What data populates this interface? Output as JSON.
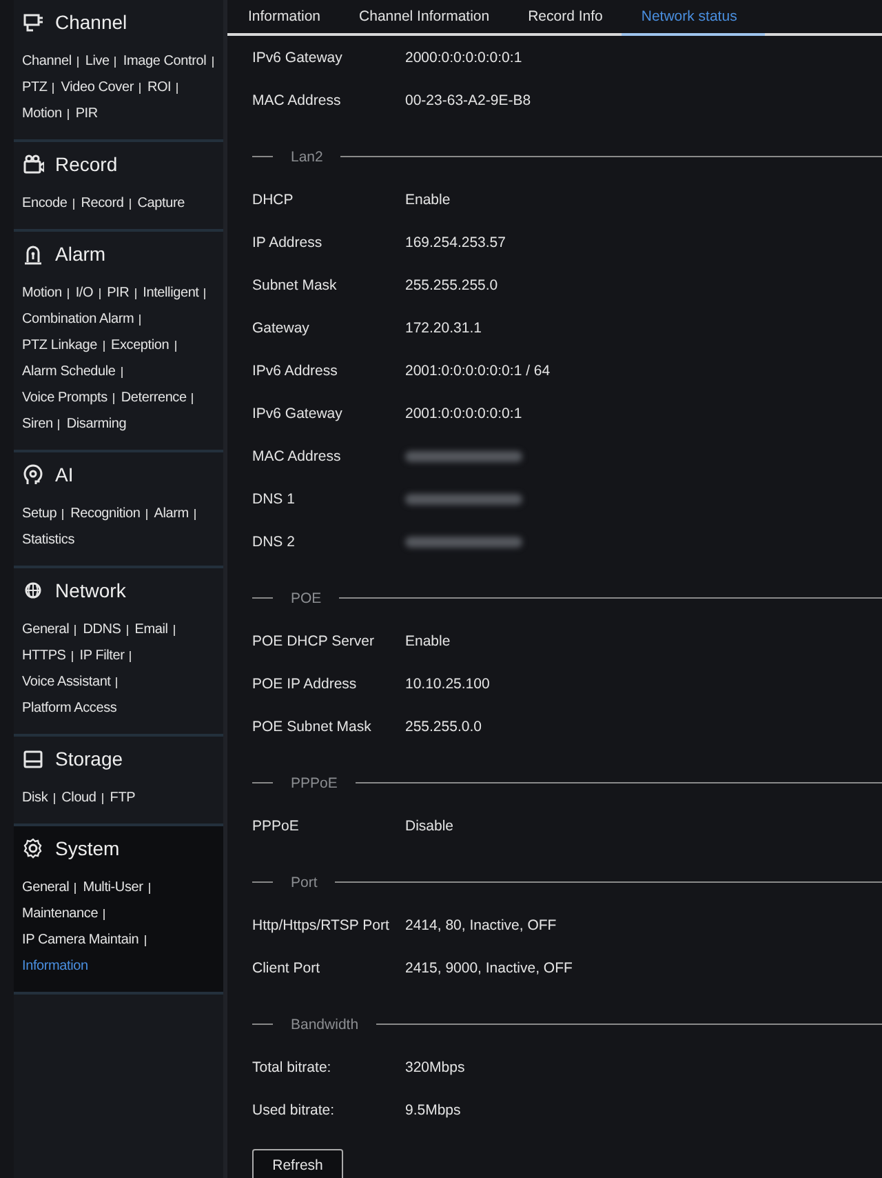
{
  "sidebar": {
    "sections": [
      {
        "title": "Channel",
        "selected": false,
        "links": [
          {
            "label": "Channel",
            "selected": false
          },
          {
            "label": "Live",
            "selected": false
          },
          {
            "label": "Image Control",
            "selected": false
          },
          {
            "label": "PTZ",
            "selected": false
          },
          {
            "label": "Video Cover",
            "selected": false
          },
          {
            "label": "ROI",
            "selected": false
          },
          {
            "label": "Motion",
            "selected": false
          },
          {
            "label": "PIR",
            "selected": false
          }
        ]
      },
      {
        "title": "Record",
        "selected": false,
        "links": [
          {
            "label": "Encode",
            "selected": false
          },
          {
            "label": "Record",
            "selected": false
          },
          {
            "label": "Capture",
            "selected": false
          }
        ]
      },
      {
        "title": "Alarm",
        "selected": false,
        "links": [
          {
            "label": "Motion",
            "selected": false
          },
          {
            "label": "I/O",
            "selected": false
          },
          {
            "label": "PIR",
            "selected": false
          },
          {
            "label": "Intelligent",
            "selected": false
          },
          {
            "label": "Combination Alarm",
            "selected": false
          },
          {
            "label": "PTZ Linkage",
            "selected": false
          },
          {
            "label": "Exception",
            "selected": false
          },
          {
            "label": "Alarm Schedule",
            "selected": false
          },
          {
            "label": "Voice Prompts",
            "selected": false
          },
          {
            "label": "Deterrence",
            "selected": false
          },
          {
            "label": "Siren",
            "selected": false
          },
          {
            "label": "Disarming",
            "selected": false
          }
        ]
      },
      {
        "title": "AI",
        "selected": false,
        "links": [
          {
            "label": "Setup",
            "selected": false
          },
          {
            "label": "Recognition",
            "selected": false
          },
          {
            "label": "Alarm",
            "selected": false
          },
          {
            "label": "Statistics",
            "selected": false
          }
        ]
      },
      {
        "title": "Network",
        "selected": false,
        "links": [
          {
            "label": "General",
            "selected": false
          },
          {
            "label": "DDNS",
            "selected": false
          },
          {
            "label": "Email",
            "selected": false
          },
          {
            "label": "HTTPS",
            "selected": false
          },
          {
            "label": "IP Filter",
            "selected": false
          },
          {
            "label": "Voice Assistant",
            "selected": false
          },
          {
            "label": "Platform Access",
            "selected": false
          }
        ]
      },
      {
        "title": "Storage",
        "selected": false,
        "links": [
          {
            "label": "Disk",
            "selected": false
          },
          {
            "label": "Cloud",
            "selected": false
          },
          {
            "label": "FTP",
            "selected": false
          }
        ]
      },
      {
        "title": "System",
        "selected": true,
        "links": [
          {
            "label": "General",
            "selected": false
          },
          {
            "label": "Multi-User",
            "selected": false
          },
          {
            "label": "Maintenance",
            "selected": false
          },
          {
            "label": "IP Camera Maintain",
            "selected": false
          },
          {
            "label": "Information",
            "selected": true
          }
        ]
      }
    ]
  },
  "tabs": [
    {
      "label": "Information",
      "selected": false
    },
    {
      "label": "Channel Information",
      "selected": false
    },
    {
      "label": "Record Info",
      "selected": false
    },
    {
      "label": "Network status",
      "selected": true
    }
  ],
  "content": {
    "sections": [
      {
        "rows": [
          {
            "label": "IPv6 Gateway",
            "value": "2000:0:0:0:0:0:0:1"
          },
          {
            "label": "MAC Address",
            "value": "00-23-63-A2-9E-B8"
          }
        ]
      },
      {
        "title": "Lan2",
        "rows": [
          {
            "label": "DHCP",
            "value": "Enable"
          },
          {
            "label": "IP Address",
            "value": "169.254.253.57"
          },
          {
            "label": "Subnet Mask",
            "value": "255.255.255.0"
          },
          {
            "label": "Gateway",
            "value": "172.20.31.1"
          },
          {
            "label": "IPv6 Address",
            "value": "2001:0:0:0:0:0:0:1 / 64"
          },
          {
            "label": "IPv6 Gateway",
            "value": "2001:0:0:0:0:0:0:1"
          },
          {
            "label": "MAC Address",
            "redacted": true
          },
          {
            "label": "DNS 1",
            "redacted": true
          },
          {
            "label": "DNS 2",
            "redacted": true
          }
        ]
      },
      {
        "title": "POE",
        "rows": [
          {
            "label": "POE DHCP Server",
            "value": "Enable"
          },
          {
            "label": "POE IP Address",
            "value": "10.10.25.100"
          },
          {
            "label": "POE Subnet Mask",
            "value": "255.255.0.0"
          }
        ]
      },
      {
        "title": "PPPoE",
        "rows": [
          {
            "label": "PPPoE",
            "value": "Disable"
          }
        ]
      },
      {
        "title": "Port",
        "rows": [
          {
            "label": "Http/Https/RTSP Port",
            "value": "2414, 80, Inactive, OFF"
          },
          {
            "label": "Client Port",
            "value": "2415, 9000, Inactive, OFF"
          }
        ]
      },
      {
        "title": "Bandwidth",
        "rows": [
          {
            "label": "Total bitrate:",
            "value": "320Mbps"
          },
          {
            "label": "Used bitrate:",
            "value": "9.5Mbps"
          }
        ]
      }
    ]
  },
  "refresh_button": {
    "label": "Refresh"
  }
}
